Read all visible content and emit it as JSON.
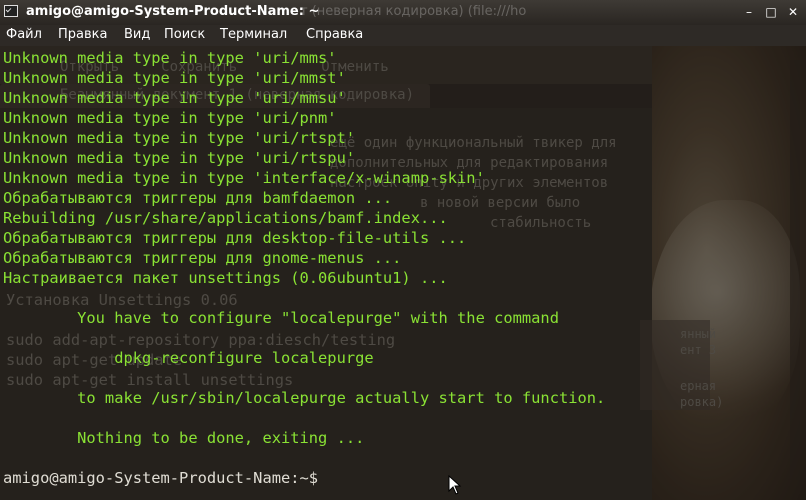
{
  "window": {
    "title": "amigo@amigo-System-Product-Name: ~",
    "ghost_title": "т (неверная кодировка) (file:///ho"
  },
  "menu": [
    "Файл",
    "Правка",
    "Вид",
    "Поиск",
    "Терминал",
    "Справка"
  ],
  "background_ghost": [
    "Открыть     Сохранить          Отменить",
    "Безымянный документ 1 (неверная кодировка)",
    "ещё один функциональный твикер для",
    "дополнительных для редактирования",
    "настроек Unity и других элементов",
    "в новой версии было",
    "стабильность",
    "Установка Unsettings 0.06",
    "sudo add-apt-repository ppa:diesch/testing",
    "sudo apt-get update",
    "sudo apt-get install unsettings",
    "янный",
    "ент 3",
    "ерная",
    "ровка)"
  ],
  "terminal_lines": [
    {
      "text": "Unknown media type in type 'uri/mms'",
      "style": "g"
    },
    {
      "text": "Unknown media type in type 'uri/mmst'",
      "style": "g"
    },
    {
      "text": "Unknown media type in type 'uri/mmsu'",
      "style": "g"
    },
    {
      "text": "Unknown media type in type 'uri/pnm'",
      "style": "g"
    },
    {
      "text": "Unknown media type in type 'uri/rtspt'",
      "style": "g"
    },
    {
      "text": "Unknown media type in type 'uri/rtspu'",
      "style": "g"
    },
    {
      "text": "Unknown media type in type 'interface/x-winamp-skin'",
      "style": "g"
    },
    {
      "text": "Обрабатываются триггеры для bamfdaemon ...",
      "style": "g"
    },
    {
      "text": "Rebuilding /usr/share/applications/bamf.index...",
      "style": "g"
    },
    {
      "text": "Обрабатываются триггеры для desktop-file-utils ...",
      "style": "g"
    },
    {
      "text": "Обрабатываются триггеры для gnome-menus ...",
      "style": "g"
    },
    {
      "text": "Настраивается пакет unsettings (0.06ubuntu1) ...",
      "style": "g"
    },
    {
      "text": "",
      "style": "g"
    },
    {
      "text": "        You have to configure \"localepurge\" with the command",
      "style": "g"
    },
    {
      "text": "",
      "style": "g"
    },
    {
      "text": "            dpkg-reconfigure localepurge",
      "style": "g"
    },
    {
      "text": "",
      "style": "g"
    },
    {
      "text": "        to make /usr/sbin/localepurge actually start to function.",
      "style": "g"
    },
    {
      "text": "",
      "style": "g"
    },
    {
      "text": "        Nothing to be done, exiting ...",
      "style": "g"
    },
    {
      "text": "",
      "style": "g"
    },
    {
      "text": "amigo@amigo-System-Product-Name:~$",
      "style": "prompt"
    }
  ]
}
